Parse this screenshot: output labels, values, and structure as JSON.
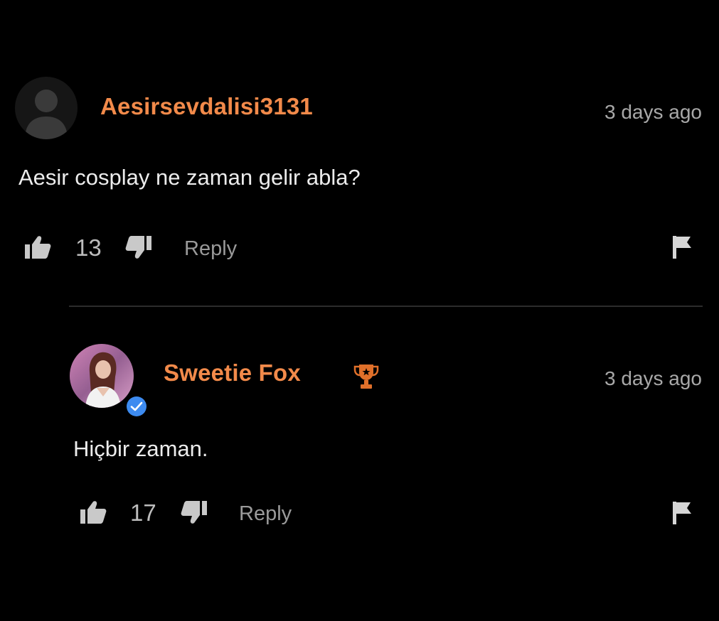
{
  "comments": [
    {
      "username": "Aesirsevdalisi3131",
      "timestamp": "3 days ago",
      "text": "Aesir cosplay ne zaman gelir abla?",
      "likes": "13",
      "reply_label": "Reply",
      "avatar_icon": "default-user-silhouette-icon"
    },
    {
      "username": "Sweetie Fox",
      "timestamp": "3 days ago",
      "text": "Hiçbir zaman.",
      "likes": "17",
      "reply_label": "Reply",
      "avatar_icon": "profile-photo",
      "badges": [
        "verified-check-icon",
        "trophy-icon"
      ]
    }
  ],
  "colors": {
    "background": "#000000",
    "username": "#f28a4a",
    "verified": "#3d8bf0",
    "trophy": "#e0702a"
  }
}
